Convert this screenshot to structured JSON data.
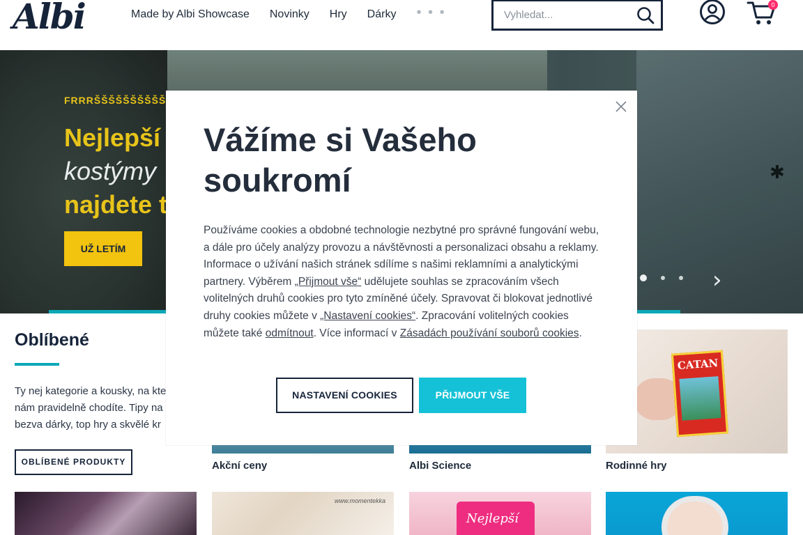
{
  "header": {
    "logo_text": "Albi",
    "nav": [
      "Made by Albi Showcase",
      "Novinky",
      "Hry",
      "Dárky"
    ],
    "nav_more": "• • •",
    "search_placeholder": "Vyhledat...",
    "cart_count": "0"
  },
  "hero": {
    "kicker": "FRRRŠŠŠŠŠŠŠŠŠŠŠŠTI",
    "title_line1": "Nejlepší č",
    "title_line2": "kostýmy",
    "title_line3": "najdete t",
    "button": "UŽ LETÍM",
    "slide_count": 3,
    "active_slide": 1
  },
  "favorites": {
    "title": "Oblíbené",
    "text": "Ty nej kategorie a kousky, na kte nám pravidelně chodíte. Tipy na bezva dárky, top hry a skvělé kr",
    "button": "OBLÍBENÉ PRODUKTY",
    "tiles": [
      {
        "label": "Akční ceny"
      },
      {
        "label": "Albi Science"
      },
      {
        "label": "Rodinné hry"
      }
    ],
    "catan_label": "CATAN",
    "mug_text": "Nejlepší",
    "card_text": "www.momentekka"
  },
  "modal": {
    "title": "Vážíme si Vašeho soukromí",
    "body_1": "Používáme cookies a obdobné technologie nezbytné pro správné fungování webu, a dále pro účely analýzy provozu a návštěvnosti a personalizaci obsahu a reklamy. Informace o užívání našich stránek sdílíme s našimi reklamními a analytickými partnery. Výběrem ",
    "link_accept": "„Přijmout vše“",
    "body_2": " udělujete souhlas se zpracováním všech volitelných druhů cookies pro tyto zmíněné účely. Spravovat či blokovat jednotlivé druhy cookies můžete v ",
    "link_settings": "„Nastavení cookies“",
    "body_3": ". Zpracování volitelných cookies můžete také ",
    "link_refuse": "odmítnout",
    "body_4": ". Více informací v ",
    "link_policy": "Zásadách používání souborů cookies",
    "body_5": ".",
    "btn_settings": "NASTAVENÍ COOKIES",
    "btn_accept": "PŘIJMOUT VŠE"
  },
  "colors": {
    "accent_teal": "#15c1d6",
    "brand_navy": "#16243a",
    "hero_yellow": "#f2c30f",
    "badge_pink": "#ff2b6a"
  }
}
